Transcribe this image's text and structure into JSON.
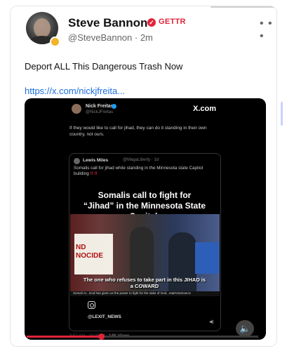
{
  "post": {
    "author_name": "Steve Bannon",
    "platform": "GETTR",
    "handle_time": "@SteveBannon · 2m",
    "menu_icon": "more-horizontal-icon",
    "text": "Deport ALL This Dangerous Trash Now",
    "link": "https://x.com/nickjfreita..."
  },
  "video": {
    "tweet_author": "Nick Freitas",
    "tweet_handle": "@NickJFreitas",
    "brand": "X.com",
    "tweet_text": "If they would like to call for jihad, they can do it standing in their own country, not ours.",
    "quote": {
      "author": "Lewis Miles",
      "handle": "@MagaLiberty · 1d",
      "text": "Somalis call for jihad while standing in the Minnesota state Capitol building",
      "text_emph": "!! !!",
      "headline": "Somalis call to fight for “Jihad” in the Minnesota State Capital.",
      "sign_text": "ND\nNOCIDE",
      "caption": "The one who refuses to take part in this JIHAD is a COWARD",
      "ticker": "Somali Ar...God has given us the power to fight for the sake of God...realAmericas.tv",
      "watermark": "@LEXIT_NEWS"
    },
    "time_views": "3:52 AM · 10/25/24 ·",
    "views": "14K Views",
    "progress_fraction": 0.32
  },
  "colors": {
    "accent": "#e0243a",
    "link": "#1d6fe0",
    "verified_x": "#1d9bf0"
  }
}
